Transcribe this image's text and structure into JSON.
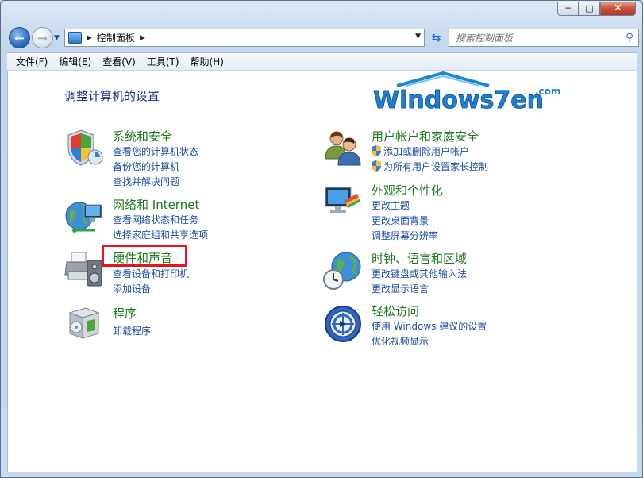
{
  "window": {
    "caption": {
      "minimize": "─",
      "maximize": "□",
      "close": "✕"
    }
  },
  "nav": {
    "back_icon": "arrow-left-icon",
    "forward_icon": "arrow-right-icon",
    "breadcrumb": "控制面板",
    "search_placeholder": "搜索控制面板"
  },
  "menu": [
    {
      "label": "文件(F)"
    },
    {
      "label": "编辑(E)"
    },
    {
      "label": "查看(V)"
    },
    {
      "label": "工具(T)"
    },
    {
      "label": "帮助(H)"
    }
  ],
  "page": {
    "title": "调整计算机的设置",
    "logo_text": "Windows7en",
    "logo_sub": ".com"
  },
  "categories": [
    {
      "title": "系统和安全",
      "icon": "shield-icon",
      "links": [
        "查看您的计算机状态",
        "备份您的计算机",
        "查找并解决问题"
      ]
    },
    {
      "title": "网络和 Internet",
      "icon": "network-globe-icon",
      "links": [
        "查看网络状态和任务",
        "选择家庭组和共享选项"
      ]
    },
    {
      "title": "硬件和声音",
      "icon": "printer-speaker-icon",
      "links": [
        "查看设备和打印机",
        "添加设备"
      ]
    },
    {
      "title": "程序",
      "icon": "programs-box-icon",
      "links": [
        "卸载程序"
      ]
    },
    {
      "title": "用户帐户和家庭安全",
      "icon": "users-icon",
      "links": [
        "添加或删除用户帐户",
        "为所有用户设置家长控制"
      ]
    },
    {
      "title": "外观和个性化",
      "icon": "monitor-palette-icon",
      "links": [
        "更改主题",
        "更改桌面背景",
        "调整屏幕分辨率"
      ]
    },
    {
      "title": "时钟、语言和区域",
      "icon": "clock-globe-icon",
      "links": [
        "更改键盘或其他输入法",
        "更改显示语言"
      ]
    },
    {
      "title": "轻松访问",
      "icon": "ease-of-access-icon",
      "links": [
        "使用 Windows 建议的设置",
        "优化视频显示"
      ]
    }
  ]
}
